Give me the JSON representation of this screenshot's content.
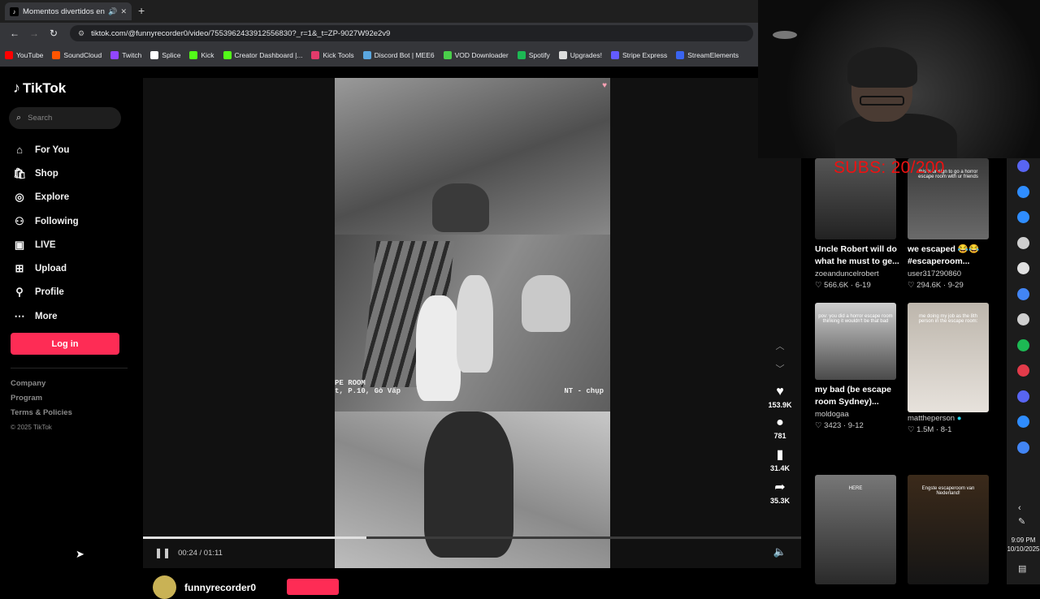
{
  "browser": {
    "tab_title": "Momentos divertidos en el",
    "url": "tiktok.com/@funnyrecorder0/video/7553962433912556830?_r=1&_t=ZP-9027W92e2v9",
    "bookmarks": [
      {
        "label": "YouTube",
        "color": "#ff0000"
      },
      {
        "label": "SoundCloud",
        "color": "#ff5500"
      },
      {
        "label": "Twitch",
        "color": "#9146ff"
      },
      {
        "label": "Splice",
        "color": "#ffffff"
      },
      {
        "label": "Kick",
        "color": "#53fc18"
      },
      {
        "label": "Creator Dashboard |...",
        "color": "#53fc18"
      },
      {
        "label": "Kick Tools",
        "color": "#e23b6b"
      },
      {
        "label": "Discord Bot | MEE6",
        "color": "#5aa7e0"
      },
      {
        "label": "VOD Downloader",
        "color": "#4ad04a"
      },
      {
        "label": "Spotify",
        "color": "#1db954"
      },
      {
        "label": "Upgrades!",
        "color": "#dddddd"
      },
      {
        "label": "Stripe Express",
        "color": "#635bff"
      },
      {
        "label": "StreamElements",
        "color": "#3a64f0"
      }
    ]
  },
  "sidebar": {
    "logo": "TikTok",
    "search_placeholder": "Search",
    "nav": [
      {
        "label": "For You",
        "icon": "home-icon",
        "glyph": "⌂"
      },
      {
        "label": "Shop",
        "icon": "shop-icon",
        "glyph": "🛍"
      },
      {
        "label": "Explore",
        "icon": "compass-icon",
        "glyph": "◎"
      },
      {
        "label": "Following",
        "icon": "following-icon",
        "glyph": "⚇"
      },
      {
        "label": "LIVE",
        "icon": "live-icon",
        "glyph": "▣"
      },
      {
        "label": "Upload",
        "icon": "upload-icon",
        "glyph": "⊞"
      },
      {
        "label": "Profile",
        "icon": "profile-icon",
        "glyph": "⚲"
      },
      {
        "label": "More",
        "icon": "more-icon",
        "glyph": "⋯"
      }
    ],
    "login_label": "Log in",
    "footer": [
      "Company",
      "Program",
      "Terms & Policies"
    ],
    "copyright": "© 2025 TikTok"
  },
  "player": {
    "overlay_left": "PE ROOM\nt, P.10, Gò Vấp",
    "overlay_right": "NT - chụp",
    "time": "00:24 / 01:11",
    "progress": 0.34
  },
  "actions": {
    "likes": "153.9K",
    "comments": "781",
    "saves": "31.4K",
    "shares": "35.3K"
  },
  "author": {
    "name": "funnyrecorder0"
  },
  "stream_overlay": {
    "subs_goal": "SUBS: 20/200"
  },
  "feed": [
    {
      "title": "Uncle Robert will do what he must to ge...",
      "user": "zoeanduncelrobert",
      "likes": "566.6K",
      "date": "6-19",
      "thumb_text": ""
    },
    {
      "title": "we escaped 😂😂 #escaperoom...",
      "user": "user317290860",
      "likes": "294.6K",
      "date": "9-29",
      "thumb_text": "this is ur sign to go a horror escape room with ur friends"
    },
    {
      "title": "my bad (be escape room Sydney)...",
      "user": "moldogaa",
      "likes": "3423",
      "date": "9-12",
      "thumb_text": "pov: you did a horror escape room thinking it wouldn't be that bad"
    },
    {
      "title": "",
      "user": "mattheperson",
      "likes": "1.5M",
      "date": "8-1",
      "thumb_text": "me doing my job as the 8th person in the escape room:"
    },
    {
      "title": "",
      "user": "",
      "likes": "",
      "date": "",
      "thumb_text": "HERE"
    },
    {
      "title": "",
      "user": "",
      "likes": "",
      "date": "",
      "thumb_text": "Engste escaperoom van Nederland!"
    }
  ],
  "taskbar": {
    "time": "9:09 PM",
    "date": "10/10/2025"
  }
}
